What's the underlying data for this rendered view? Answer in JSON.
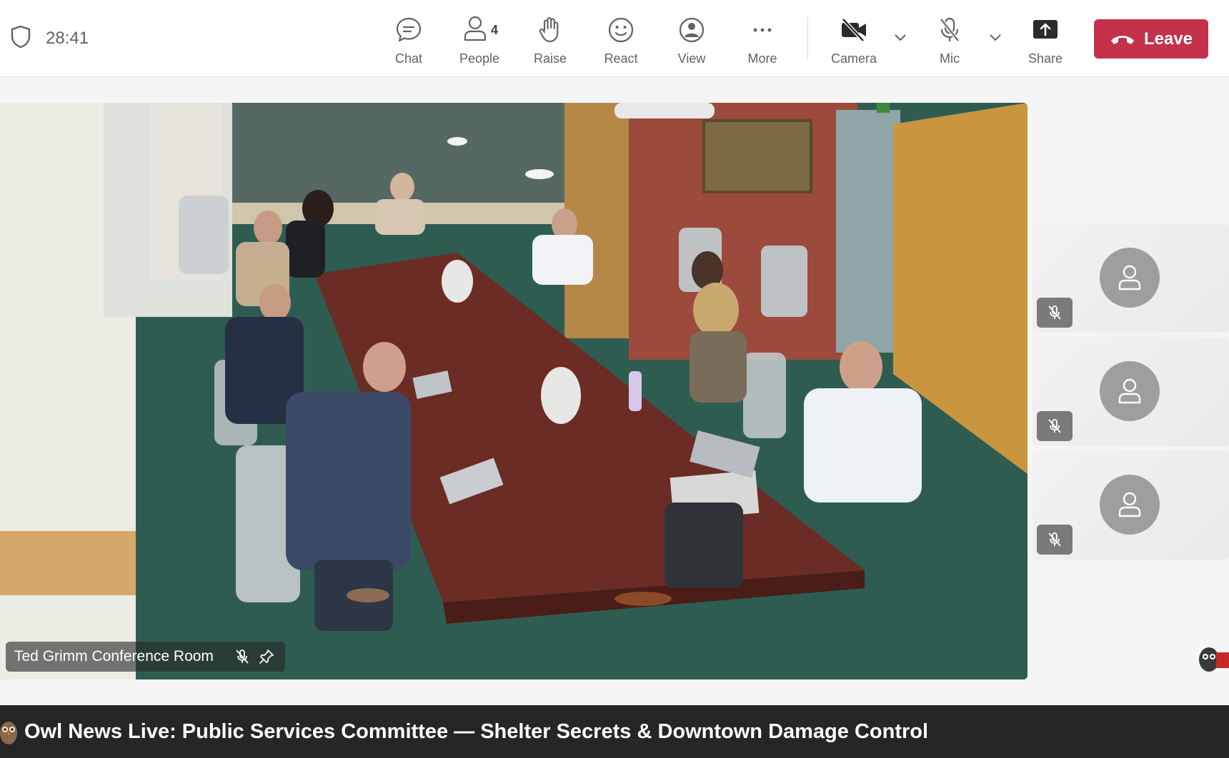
{
  "toolbar": {
    "timer": "28:41",
    "chat_label": "Chat",
    "people_label": "People",
    "people_count": "4",
    "raise_label": "Raise",
    "react_label": "React",
    "view_label": "View",
    "more_label": "More",
    "camera_label": "Camera",
    "mic_label": "Mic",
    "share_label": "Share",
    "leave_label": "Leave"
  },
  "main_video": {
    "participant_name": "Ted Grimm Conference Room",
    "muted": true,
    "pinned": true
  },
  "side_tiles": [
    {
      "muted": true,
      "icon": "person-icon"
    },
    {
      "muted": true,
      "icon": "person-icon"
    },
    {
      "muted": true,
      "icon": "person-icon"
    }
  ],
  "ticker": {
    "text": "Owl News Live: Public Services Committee — Shelter Secrets & Downtown Damage Control"
  },
  "colors": {
    "leave_red": "#c4314b",
    "toolbar_text": "#616161",
    "ticker_bg": "#262626"
  }
}
